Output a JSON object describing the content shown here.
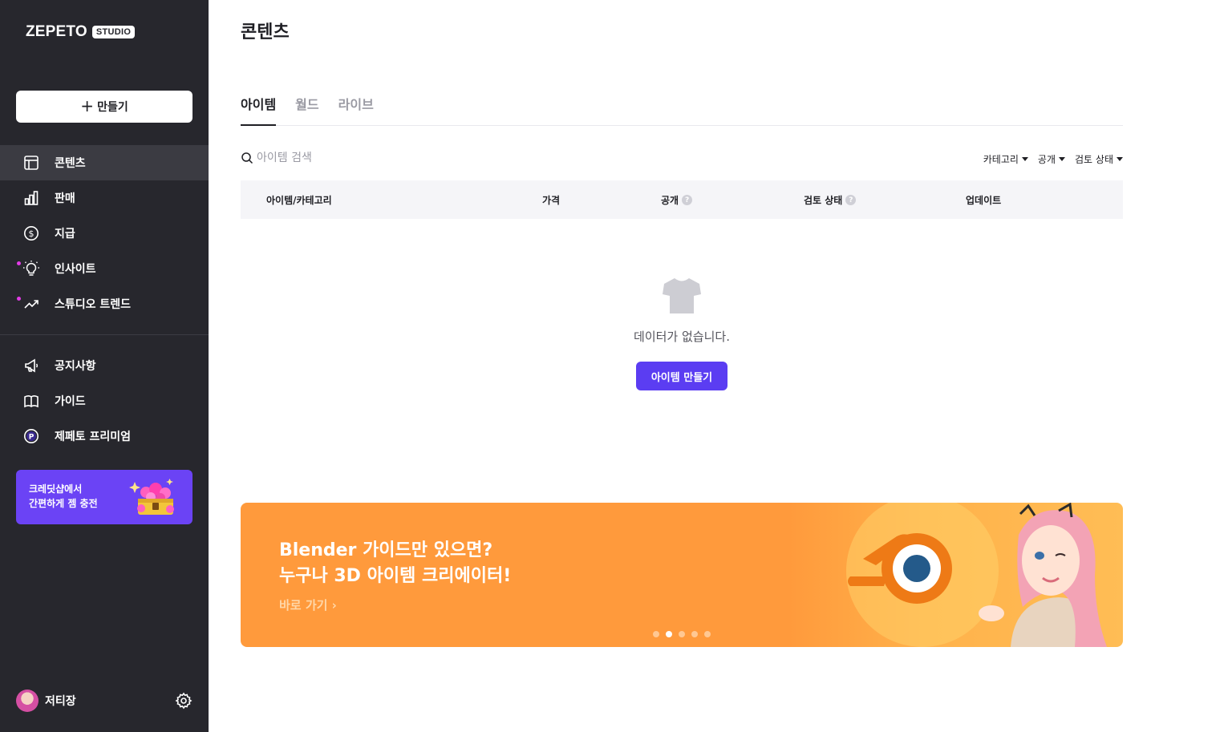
{
  "brand": {
    "name": "ZEPETO",
    "badge": "STUDIO"
  },
  "sidebar": {
    "create_label": "만들기",
    "items": [
      {
        "label": "콘텐츠",
        "icon": "layout-icon",
        "active": true,
        "new_dot": false
      },
      {
        "label": "판매",
        "icon": "bar-chart-icon",
        "active": false,
        "new_dot": false
      },
      {
        "label": "지급",
        "icon": "dollar-circle-icon",
        "active": false,
        "new_dot": false
      },
      {
        "label": "인사이트",
        "icon": "lightbulb-icon",
        "active": false,
        "new_dot": true
      },
      {
        "label": "스튜디오 트렌드",
        "icon": "trend-up-icon",
        "active": false,
        "new_dot": true
      }
    ],
    "secondary_items": [
      {
        "label": "공지사항",
        "icon": "megaphone-icon"
      },
      {
        "label": "가이드",
        "icon": "book-icon"
      },
      {
        "label": "제페토 프리미엄",
        "icon": "premium-p-icon"
      }
    ],
    "promo": {
      "line1": "크레딧샵에서",
      "line2": "간편하게 젬 충전"
    },
    "user": {
      "name": "저티장"
    }
  },
  "main": {
    "title": "콘텐츠",
    "tabs": [
      {
        "label": "아이템",
        "active": true
      },
      {
        "label": "월드",
        "active": false
      },
      {
        "label": "라이브",
        "active": false
      }
    ],
    "search": {
      "placeholder": "아이템 검색",
      "value": ""
    },
    "filters": [
      "카테고리",
      "공개",
      "검토 상태"
    ],
    "table": {
      "columns": [
        "아이템/카테고리",
        "가격",
        "공개",
        "검토 상태",
        "업데이트"
      ],
      "help_mark": "?"
    },
    "empty": {
      "message": "데이터가 없습니다.",
      "button_label": "아이템 만들기"
    },
    "banner": {
      "line1": "Blender 가이드만 있으면?",
      "line2": "누구나 3D 아이템 크리에이터!",
      "link": "바로 가기 ›",
      "slides": 5,
      "active_slide": 2
    }
  },
  "colors": {
    "sidebar": "#27272d",
    "accent": "#5b3df2",
    "promo": "#6b43f5",
    "banner": "#ff9a3c",
    "new_dot": "#e23ce6"
  }
}
